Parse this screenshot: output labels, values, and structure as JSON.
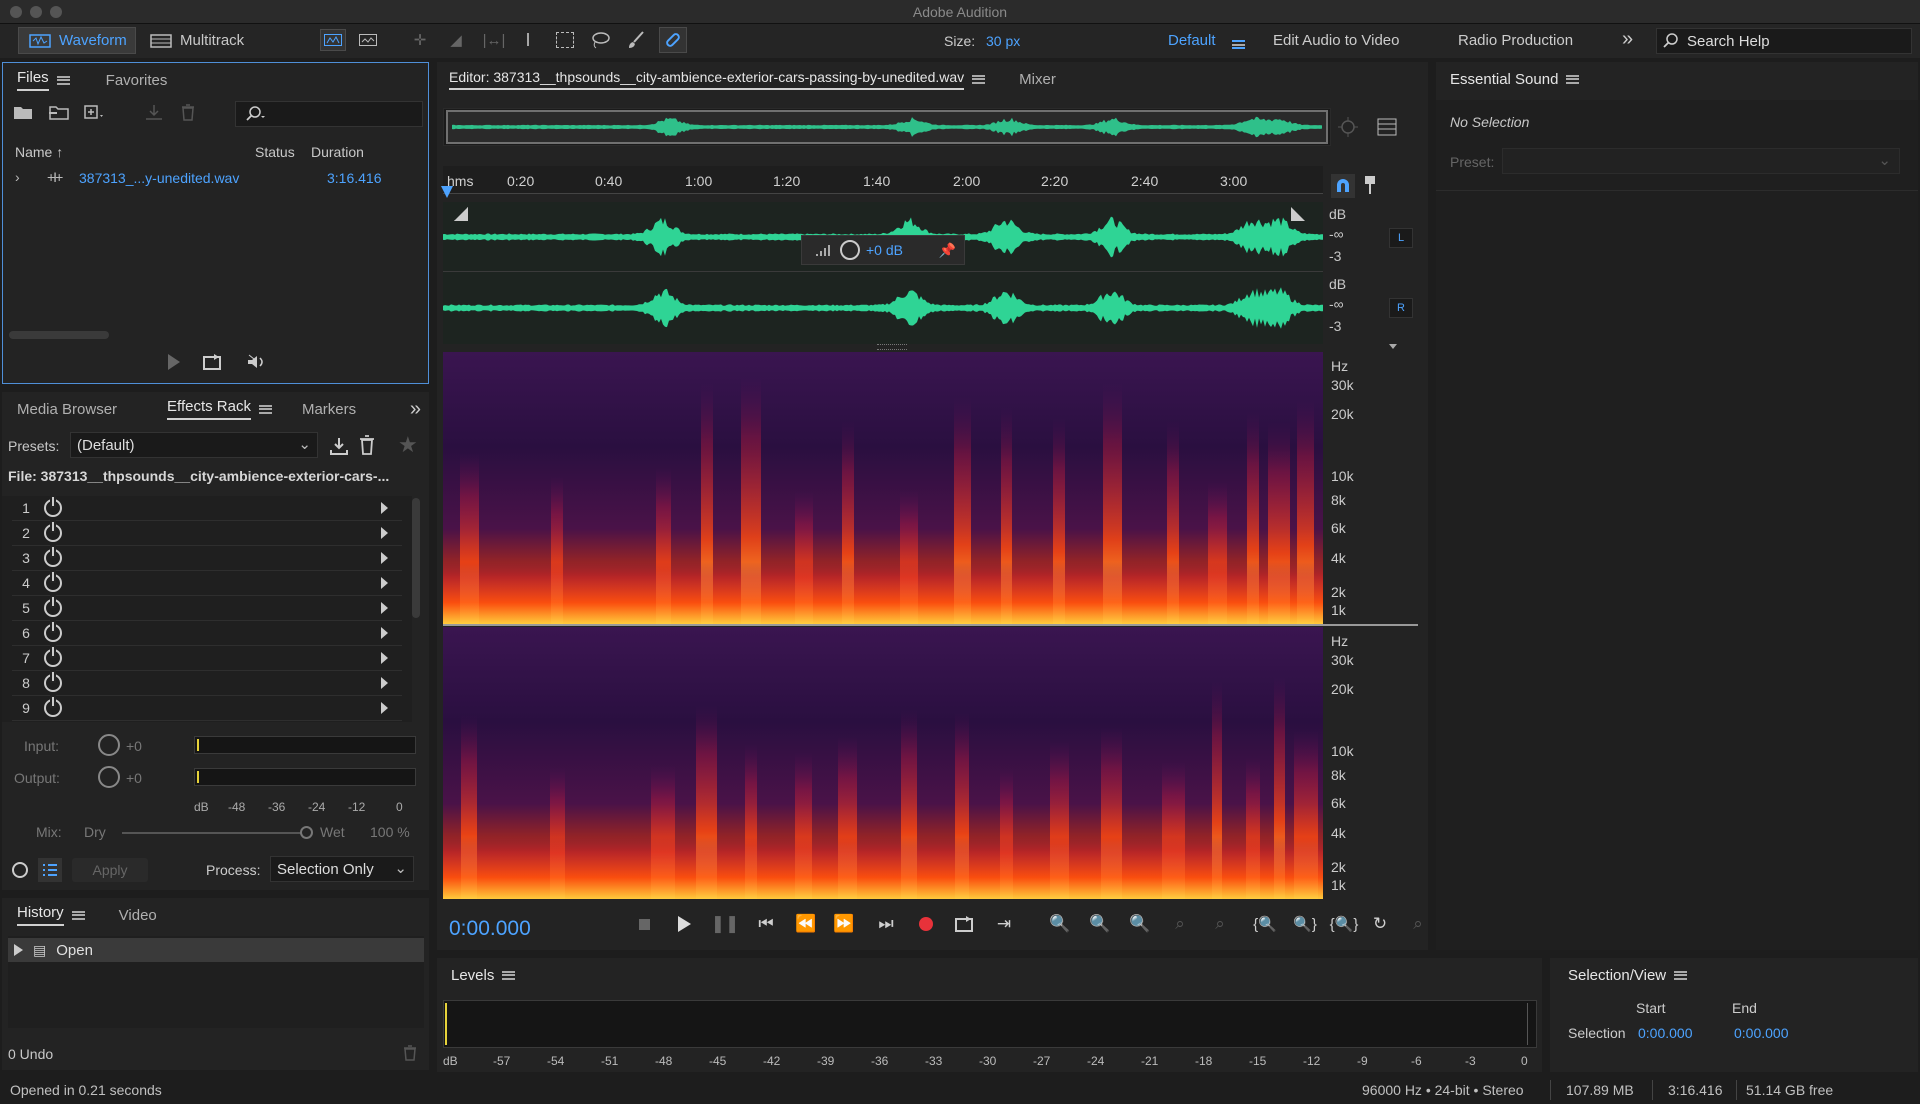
{
  "window": {
    "title": "Adobe Audition"
  },
  "toolbar": {
    "waveform_label": "Waveform",
    "multitrack_label": "Multitrack",
    "size_label": "Size:",
    "size_value": "30 px",
    "workspaces": [
      "Default",
      "Edit Audio to Video",
      "Radio Production"
    ],
    "search_placeholder": "Search Help"
  },
  "files_panel": {
    "tabs": [
      "Files",
      "Favorites"
    ],
    "columns": [
      "Name",
      "Status",
      "Duration"
    ],
    "rows": [
      {
        "name": "387313_...y-unedited.wav",
        "duration": "3:16.416"
      }
    ]
  },
  "effects_panel": {
    "tabs": [
      "Media Browser",
      "Effects Rack",
      "Markers"
    ],
    "presets_label": "Presets:",
    "presets_value": "(Default)",
    "file_label": "File: 387313__thpsounds__city-ambience-exterior-cars-...",
    "slots": [
      "1",
      "2",
      "3",
      "4",
      "5",
      "6",
      "7",
      "8",
      "9"
    ],
    "input_label": "Input:",
    "input_value": "+0",
    "output_label": "Output:",
    "output_value": "+0",
    "meter_scale": [
      "dB",
      "-48",
      "-36",
      "-24",
      "-12",
      "0"
    ],
    "mix_label": "Mix:",
    "dry_label": "Dry",
    "wet_label": "Wet",
    "wet_value": "100 %",
    "apply_label": "Apply",
    "process_label": "Process:",
    "process_value": "Selection Only"
  },
  "history_panel": {
    "tabs": [
      "History",
      "Video"
    ],
    "items": [
      "Open"
    ],
    "undo_label": "0 Undo"
  },
  "editor": {
    "tab_label": "Editor: 387313__thpsounds__city-ambience-exterior-cars-passing-by-unedited.wav",
    "mixer_label": "Mixer",
    "ruler": [
      "hms",
      "0:20",
      "0:40",
      "1:00",
      "1:20",
      "1:40",
      "2:00",
      "2:20",
      "2:40",
      "3:00"
    ],
    "hud_gain": "+0 dB",
    "channel_left": "L",
    "channel_right": "R",
    "db_labels": [
      "dB",
      "-∞",
      "-3"
    ],
    "hz_labels": [
      "Hz",
      "30k",
      "20k",
      "10k",
      "8k",
      "6k",
      "4k",
      "2k",
      "1k"
    ],
    "timecode": "0:00.000",
    "accent": "#3fdca0"
  },
  "essential_sound": {
    "title": "Essential Sound",
    "no_selection": "No Selection",
    "preset_label": "Preset:"
  },
  "levels": {
    "title": "Levels",
    "scale": [
      "dB",
      "-57",
      "-54",
      "-51",
      "-48",
      "-45",
      "-42",
      "-39",
      "-36",
      "-33",
      "-30",
      "-27",
      "-24",
      "-21",
      "-18",
      "-15",
      "-12",
      "-9",
      "-6",
      "-3",
      "0"
    ]
  },
  "selection_view": {
    "title": "Selection/View",
    "start_label": "Start",
    "end_label": "End",
    "selection_label": "Selection",
    "start_value": "0:00.000",
    "end_value": "0:00.000"
  },
  "status_bar": {
    "message": "Opened in 0.21 seconds",
    "format": "96000 Hz • 24-bit • Stereo",
    "size": "107.89 MB",
    "duration": "3:16.416",
    "free": "51.14 GB free"
  }
}
